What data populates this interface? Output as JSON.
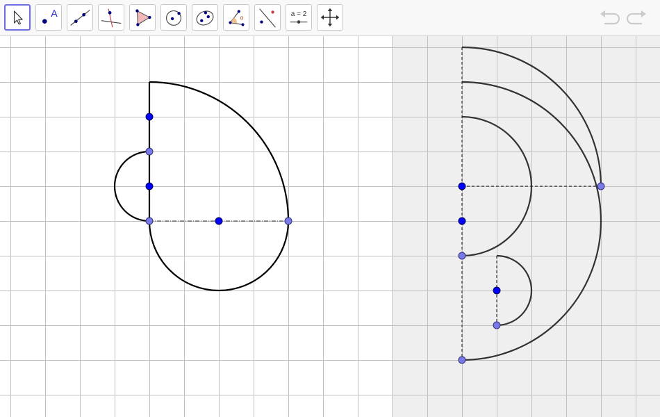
{
  "toolbar": {
    "tools": [
      {
        "name": "move-tool-button",
        "icon": "pointer-arrow-icon",
        "active": true
      },
      {
        "name": "point-tool-button",
        "icon": "point-label-icon",
        "label": "A"
      },
      {
        "name": "line-tool-button",
        "icon": "line-through-points-icon"
      },
      {
        "name": "perpendicular-tool-button",
        "icon": "perpendicular-line-icon"
      },
      {
        "name": "polygon-tool-button",
        "icon": "triangle-polygon-icon"
      },
      {
        "name": "circle-tool-button",
        "icon": "circle-center-point-icon"
      },
      {
        "name": "conic-tool-button",
        "icon": "ellipse-icon"
      },
      {
        "name": "angle-tool-button",
        "icon": "angle-icon",
        "label": "α"
      },
      {
        "name": "reflect-tool-button",
        "icon": "reflect-point-icon"
      },
      {
        "name": "slider-tool-button",
        "icon": "slider-icon",
        "label": "a = 2"
      },
      {
        "name": "move-view-tool-button",
        "icon": "move-arrows-icon"
      }
    ],
    "undo_icon": "undo-icon",
    "redo_icon": "redo-icon"
  },
  "graphics": {
    "views": [
      {
        "name": "graphics-view-1",
        "background": "#ffffff"
      },
      {
        "name": "graphics-view-2",
        "background": "#efefef"
      }
    ],
    "colors": {
      "grid": "#c0c0c0",
      "curve": "#000000",
      "curve2": "#333333",
      "point_free": "#0000ff",
      "point_dependent": "#7a7ae6"
    }
  }
}
